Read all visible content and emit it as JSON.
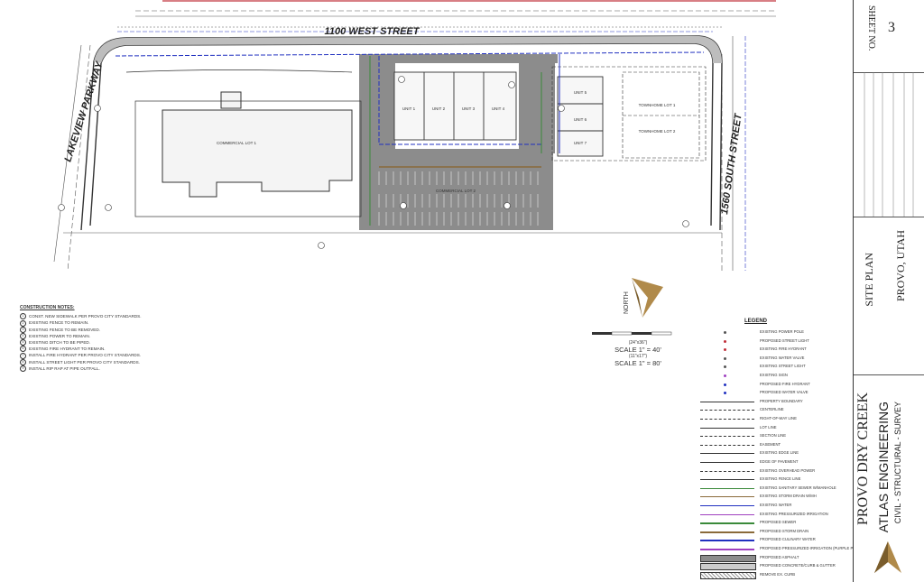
{
  "streets": {
    "north": "1100 WEST STREET",
    "west": "LAKEVIEW PARKWAY",
    "east": "1560 SOUTH STREET"
  },
  "lots": {
    "commercial": "COMMERCIAL LOT 1",
    "commercial2": "COMMERCIAL LOT 2",
    "townhome1": "TOWNHOME LOT 1",
    "townhome2": "TOWNHOME LOT 2",
    "units": [
      "UNIT 1",
      "UNIT 2",
      "UNIT 3",
      "UNIT 4"
    ],
    "units_east": [
      "UNIT 5",
      "UNIT 6",
      "UNIT 7"
    ]
  },
  "north_arrow": "NORTH",
  "scale": {
    "sheet_a": "(24\"x36\")",
    "line_a": "SCALE  1\" = 40'",
    "sheet_b": "(11\"x17\")",
    "line_b": "SCALE  1\" = 80'"
  },
  "construction_notes": {
    "heading": "CONSTRUCTION NOTES:",
    "items": [
      "CONST. NEW SIDEWALK PER PROVO CITY STANDARDS.",
      "EXISTING FENCE TO REMAIN.",
      "EXISTING FENCE TO BE REMOVED.",
      "EXISTING POWER TO REMAIN.",
      "EXISTING DITCH TO BE PIPED.",
      "EXISTING FIRE HYDRANT TO REMAIN.",
      "INSTALL FIRE HYDRANT PER PROVO CITY STANDARDS.",
      "INSTALL STREET LIGHT PER PROVO CITY STANDARDS.",
      "INSTALL RIP RAP AT PIPE OUTFALL."
    ]
  },
  "legend": {
    "heading": "LEGEND",
    "items": [
      {
        "label": "EXISTING POWER POLE",
        "color": "#555555",
        "style": "dot"
      },
      {
        "label": "PROPOSED STREET LIGHT",
        "color": "#c0303a",
        "style": "dot"
      },
      {
        "label": "EXISTING FIRE HYDRANT",
        "color": "#c0303a",
        "style": "dot"
      },
      {
        "label": "EXISTING WATER VALVE",
        "color": "#555555",
        "style": "dot"
      },
      {
        "label": "EXISTING STREET LIGHT",
        "color": "#555555",
        "style": "dot"
      },
      {
        "label": "EXISTING SIGN",
        "color": "#a040c0",
        "style": "dot"
      },
      {
        "label": "PROPOSED FIRE HYDRANT",
        "color": "#2030c0",
        "style": "dot"
      },
      {
        "label": "PROPOSED WATER VALVE",
        "color": "#2030c0",
        "style": "dot"
      },
      {
        "label": "PROPERTY BOUNDARY",
        "color": "#333333",
        "style": "solid"
      },
      {
        "label": "CENTERLINE",
        "color": "#333333",
        "style": "dashdot"
      },
      {
        "label": "RIGHT-OF-WAY LINE",
        "color": "#333333",
        "style": "dash"
      },
      {
        "label": "LOT LINE",
        "color": "#333333",
        "style": "solid"
      },
      {
        "label": "SECTION LINE",
        "color": "#333333",
        "style": "dashdot"
      },
      {
        "label": "EASEMENT",
        "color": "#333333",
        "style": "dash"
      },
      {
        "label": "EXISTING EDGE LINE",
        "color": "#333333",
        "style": "solid"
      },
      {
        "label": "EDGE OF PAVEMENT",
        "color": "#333333",
        "style": "solid"
      },
      {
        "label": "EXISTING OVERHEAD POWER",
        "color": "#333333",
        "style": "dash"
      },
      {
        "label": "EXISTING FENCE LINE",
        "color": "#333333",
        "style": "xline"
      },
      {
        "label": "EXISTING SANITARY SEWER W/MANHOLE",
        "color": "#3a8a3a",
        "style": "solid"
      },
      {
        "label": "EXISTING STORM DRAIN W/MH",
        "color": "#8a6a3a",
        "style": "solid"
      },
      {
        "label": "EXISTING WATER",
        "color": "#2030c0",
        "style": "solid"
      },
      {
        "label": "EXISTING PRESSURIZED IRRIGATION",
        "color": "#a040c0",
        "style": "solid"
      },
      {
        "label": "PROPOSED SEWER",
        "color": "#3a8a3a",
        "style": "thick"
      },
      {
        "label": "PROPOSED STORM DRAIN",
        "color": "#8a6a3a",
        "style": "thick"
      },
      {
        "label": "PROPOSED CULINARY WATER",
        "color": "#2030c0",
        "style": "thick"
      },
      {
        "label": "PROPOSED PRESSURIZED IRRIGATION (PURPLE PIPE)",
        "color": "#a040c0",
        "style": "thick"
      },
      {
        "label": "PROPOSED ASPHALT",
        "color": "#8c8c8c",
        "style": "fill"
      },
      {
        "label": "PROPOSED CONCRETE/CURB & GUTTER",
        "color": "#cccccc",
        "style": "fill"
      },
      {
        "label": "REMOVE EX. CURB",
        "color": "#999999",
        "style": "hatch"
      }
    ]
  },
  "title_block": {
    "sheet_no_label": "SHEET NO.",
    "sheet_no": "3",
    "title": "SITE PLAN",
    "location": "PROVO, UTAH",
    "project": "PROVO DRY CREEK",
    "company": "ATLAS ENGINEERING",
    "tagline": "CIVIL - STRUCTURAL - SURVEY"
  },
  "colors": {
    "asphalt": "#8c8c8c",
    "asphalt_dark": "#6e6e6e",
    "water": "#2030c0",
    "sewer": "#3a8a3a",
    "brand_gold": "#b08a4a"
  }
}
